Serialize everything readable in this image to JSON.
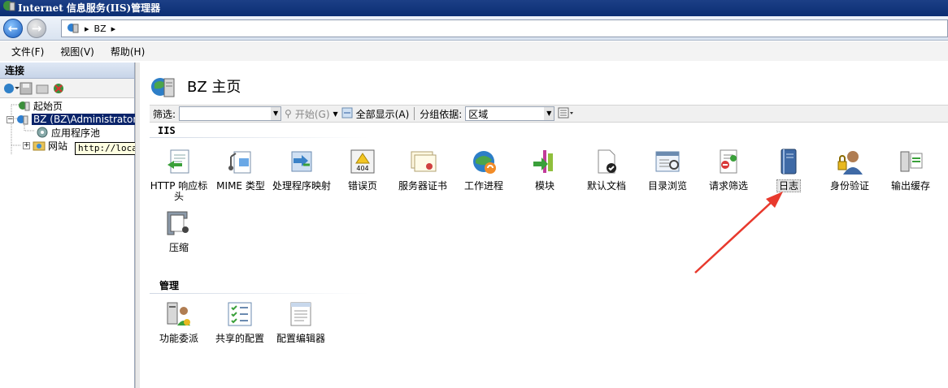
{
  "window": {
    "title": "Internet 信息服务(IIS)管理器"
  },
  "address": {
    "segments": [
      "BZ"
    ]
  },
  "menu": [
    "文件(F)",
    "视图(V)",
    "帮助(H)"
  ],
  "connections": {
    "header": "连接",
    "tree": [
      {
        "label": "起始页"
      },
      {
        "label": "BZ (BZ\\Administrator"
      },
      {
        "label": "应用程序池"
      },
      {
        "label": "网站"
      }
    ],
    "tooltip": "http://localhost/"
  },
  "page": {
    "title": "BZ 主页",
    "filter_label": "筛选:",
    "start_label": "开始(G)",
    "show_all_label": "全部显示(A)",
    "group_by_label": "分组依据:",
    "group_by_value": "区域"
  },
  "sections": {
    "iis": {
      "label": "IIS",
      "features": [
        {
          "label": "HTTP 响应标头",
          "icon": "http-response-headers-icon"
        },
        {
          "label": "MIME 类型",
          "icon": "mime-types-icon"
        },
        {
          "label": "处理程序映射",
          "icon": "handler-mappings-icon"
        },
        {
          "label": "错误页",
          "icon": "error-pages-icon"
        },
        {
          "label": "服务器证书",
          "icon": "server-certificates-icon"
        },
        {
          "label": "工作进程",
          "icon": "worker-processes-icon"
        },
        {
          "label": "模块",
          "icon": "modules-icon"
        },
        {
          "label": "默认文档",
          "icon": "default-document-icon"
        },
        {
          "label": "目录浏览",
          "icon": "directory-browsing-icon"
        },
        {
          "label": "请求筛选",
          "icon": "request-filtering-icon"
        },
        {
          "label": "日志",
          "icon": "logging-icon"
        },
        {
          "label": "身份验证",
          "icon": "authentication-icon"
        },
        {
          "label": "输出缓存",
          "icon": "output-caching-icon"
        },
        {
          "label": "压缩",
          "icon": "compression-icon"
        }
      ]
    },
    "management": {
      "label": "管理",
      "features": [
        {
          "label": "功能委派",
          "icon": "feature-delegation-icon"
        },
        {
          "label": "共享的配置",
          "icon": "shared-configuration-icon"
        },
        {
          "label": "配置编辑器",
          "icon": "configuration-editor-icon"
        }
      ]
    }
  },
  "colors": {
    "titlebar": "#0b2e73",
    "selection": "#0a246a",
    "annotation_arrow": "#e8392d"
  }
}
